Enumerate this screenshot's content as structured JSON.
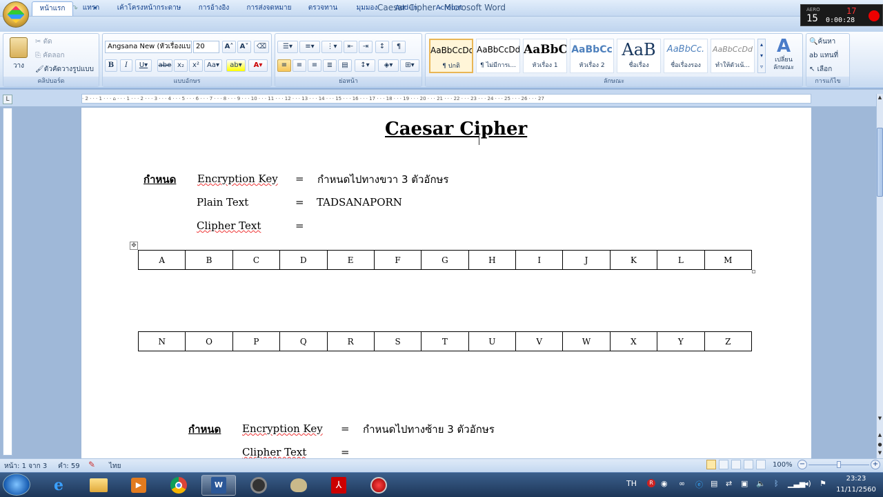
{
  "window": {
    "title": "Caesar Cipher - Microsoft Word"
  },
  "tabs": [
    "หน้าแรก",
    "แทรก",
    "เค้าโครงหน้ากระดาษ",
    "การอ้างอิง",
    "การส่งจดหมาย",
    "ตรวจทาน",
    "มุมมอง",
    "Add-In",
    "Acrobat"
  ],
  "ribbon": {
    "clipboard": {
      "paste": "วาง",
      "cut": "ตัด",
      "copy": "คัดลอก",
      "format_painter": "ตัวคัดวางรูปแบบ",
      "label": "คลิปบอร์ด"
    },
    "font": {
      "name": "Angsana New (หัวเรื่องแบ",
      "size": "20",
      "label": "แบบอักษร"
    },
    "paragraph": {
      "label": "ย่อหน้า"
    },
    "styles": {
      "label": "ลักษณะ",
      "change": "เปลี่ยน ลักษณะ",
      "items": [
        {
          "sample": "AaBbCcDd",
          "name": "¶ ปกติ"
        },
        {
          "sample": "AaBbCcDd",
          "name": "¶ ไม่มีการเ..."
        },
        {
          "sample": "AaBbC",
          "name": "หัวเรื่อง 1"
        },
        {
          "sample": "AaBbCc",
          "name": "หัวเรื่อง 2"
        },
        {
          "sample": "AaB",
          "name": "ชื่อเรื่อง"
        },
        {
          "sample": "AaBbCc.",
          "name": "ชื่อเรื่องรอง"
        },
        {
          "sample": "AaBbCcDd",
          "name": "ทำให้ตัวเน้..."
        }
      ]
    },
    "editing": {
      "find": "ค้นหา",
      "replace": "แทนที่",
      "select": "เลือก",
      "label": "การแก้ไข"
    }
  },
  "ruler": {
    "numbers": "· 2 · · · 1 · · · ⌂ · · · 1 · · · 2 · · · 3 · · · 4 · · · 5 · · · 6 · · · 7 · · · 8 · · · 9 · · · 10 · · · 11 · · · 12 · · · 13 · · · 14 · · · 15 · · · 16 · · · 17 · · · 18 · · · 19 · · · 20 · · · 21 · · · 22 · · · 23 · · · 24 · · · 25 · · · 26 · · · 27"
  },
  "document": {
    "title": "Caesar Cipher",
    "section1": {
      "label": "กำหนด",
      "key_label": "Encryption Key",
      "eq": "=",
      "key_value": "กำหนดไปทางขวา 3 ตัวอักษร",
      "plain_label": "Plain Text",
      "plain_value": "TADSANAPORN",
      "cipher_label": "Clipher Text"
    },
    "row1": [
      "A",
      "B",
      "C",
      "D",
      "E",
      "F",
      "G",
      "H",
      "I",
      "J",
      "K",
      "L",
      "M"
    ],
    "row2": [
      "N",
      "O",
      "P",
      "Q",
      "R",
      "S",
      "T",
      "U",
      "V",
      "W",
      "X",
      "Y",
      "Z"
    ],
    "section2": {
      "label": "กำหนด",
      "key_label": "Encryption Key",
      "eq": "=",
      "key_value": "กำหนดไปทางซ้าย 3 ตัวอักษร",
      "cipher_label": "Clipher Text"
    }
  },
  "status": {
    "page": "หน้า: 1 จาก 3",
    "words": "คำ: 59",
    "language": "ไทย",
    "zoom": "100%"
  },
  "taskbar": {
    "lang": "TH",
    "time": "23:23",
    "date": "11/11/2560"
  },
  "recorder": {
    "top": "17",
    "left": "15",
    "time": "0:00:28",
    "label": "AERO"
  }
}
